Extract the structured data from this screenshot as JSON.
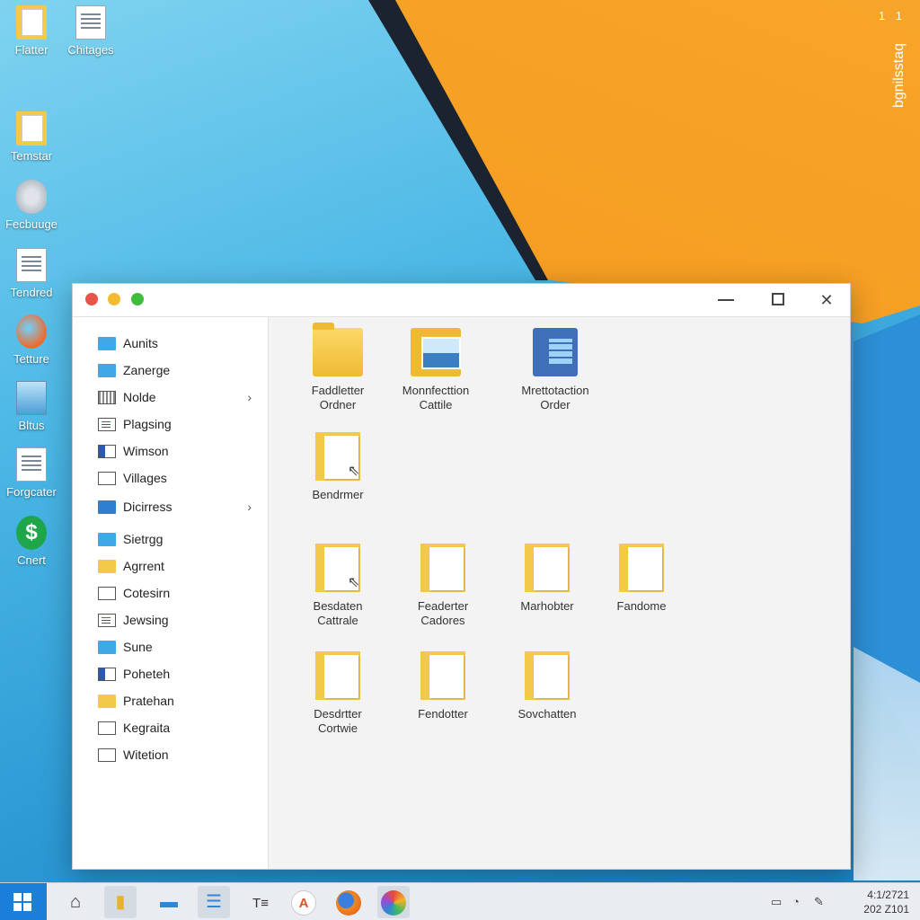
{
  "desktop": {
    "corner_text": "1 1",
    "vertical_text": "bgnilsstaq",
    "icons": [
      {
        "label": "Flatter",
        "icon": "folder-icon"
      },
      {
        "label": "Chitages",
        "icon": "window-icon"
      },
      {
        "label": "Temstar",
        "icon": "folder-icon"
      },
      {
        "label": "Fecbuuge",
        "icon": "disk-icon"
      },
      {
        "label": "Tendred",
        "icon": "document-icon"
      },
      {
        "label": "Tetture",
        "icon": "globe-icon"
      },
      {
        "label": "Bltus",
        "icon": "chart-icon"
      },
      {
        "label": "Forgcater",
        "icon": "document-icon"
      },
      {
        "label": "Cnert",
        "icon": "money-icon"
      }
    ]
  },
  "window": {
    "title": "",
    "sidebar": {
      "items": [
        {
          "label": "Aunits",
          "icon": "blue-folder-icon"
        },
        {
          "label": "Zanerge",
          "icon": "blue-folder-icon"
        },
        {
          "label": "Nolde",
          "icon": "grid-icon",
          "expandable": true
        },
        {
          "label": "Plagsing",
          "icon": "list-icon"
        },
        {
          "label": "Wimson",
          "icon": "window-icon"
        },
        {
          "label": "Villages",
          "icon": "outline-folder-icon"
        },
        {
          "label": "Dicirress",
          "icon": "dark-blue-folder-icon",
          "expandable": true
        },
        {
          "label": "Sietrgg",
          "icon": "blue-folder-icon"
        },
        {
          "label": "Agrrent",
          "icon": "yellow-folder-icon"
        },
        {
          "label": "Cotesirn",
          "icon": "outline-folder-icon"
        },
        {
          "label": "Jewsing",
          "icon": "image-icon"
        },
        {
          "label": "Sune",
          "icon": "blue-folder-icon"
        },
        {
          "label": "Poheteh",
          "icon": "document-icon"
        },
        {
          "label": "Pratehan",
          "icon": "yellow-folder-icon"
        },
        {
          "label": "Kegraita",
          "icon": "outline-folder-icon"
        },
        {
          "label": "Witetion",
          "icon": "outline-folder-icon"
        }
      ]
    },
    "files": [
      {
        "line1": "Faddletter",
        "line2": "Ordner",
        "icon": "folder-icon"
      },
      {
        "line1": "Monnfecttion",
        "line2": "Cattile",
        "icon": "image-folder-icon"
      },
      {
        "line1": "Mrettotaction",
        "line2": "Order",
        "icon": "panel-icon"
      },
      {
        "line1": "Bendrmer",
        "line2": "",
        "icon": "document-folder-icon"
      },
      {
        "line1": "Besdaten",
        "line2": "Cattrale",
        "icon": "document-folder-icon"
      },
      {
        "line1": "Feaderter",
        "line2": "Cadores",
        "icon": "document-folder-icon"
      },
      {
        "line1": "Marhobter",
        "line2": "",
        "icon": "document-folder-icon"
      },
      {
        "line1": "Fandome",
        "line2": "",
        "icon": "document-folder-icon"
      },
      {
        "line1": "Desdrtter",
        "line2": "Cortwie",
        "icon": "document-folder-icon"
      },
      {
        "line1": "Fendotter",
        "line2": "",
        "icon": "document-folder-icon"
      },
      {
        "line1": "Sovchatten",
        "line2": "",
        "icon": "document-folder-icon"
      }
    ]
  },
  "taskbar": {
    "clock_time": "4:1/2721",
    "clock_date": "202 Z101"
  }
}
